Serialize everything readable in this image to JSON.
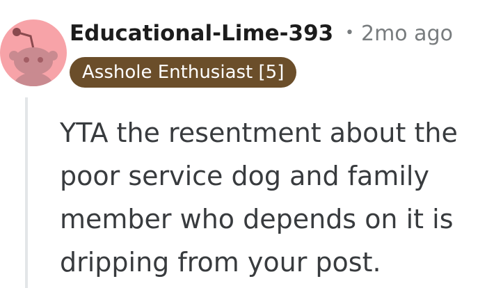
{
  "comment": {
    "author": "Educational-Lime-393",
    "separator": "•",
    "timestamp": "2mo ago",
    "flair": "Asshole Enthusiast [5]",
    "body": "YTA the resentment about the poor service dog and family member who depends on it is dripping from your post."
  },
  "avatar": {
    "icon": "snoo-avatar-icon",
    "background_color": "#f7a3a8"
  },
  "colors": {
    "flair_background": "#6b4e2a",
    "meta_text": "#787c7e",
    "thread_line": "#e3e6e8"
  }
}
